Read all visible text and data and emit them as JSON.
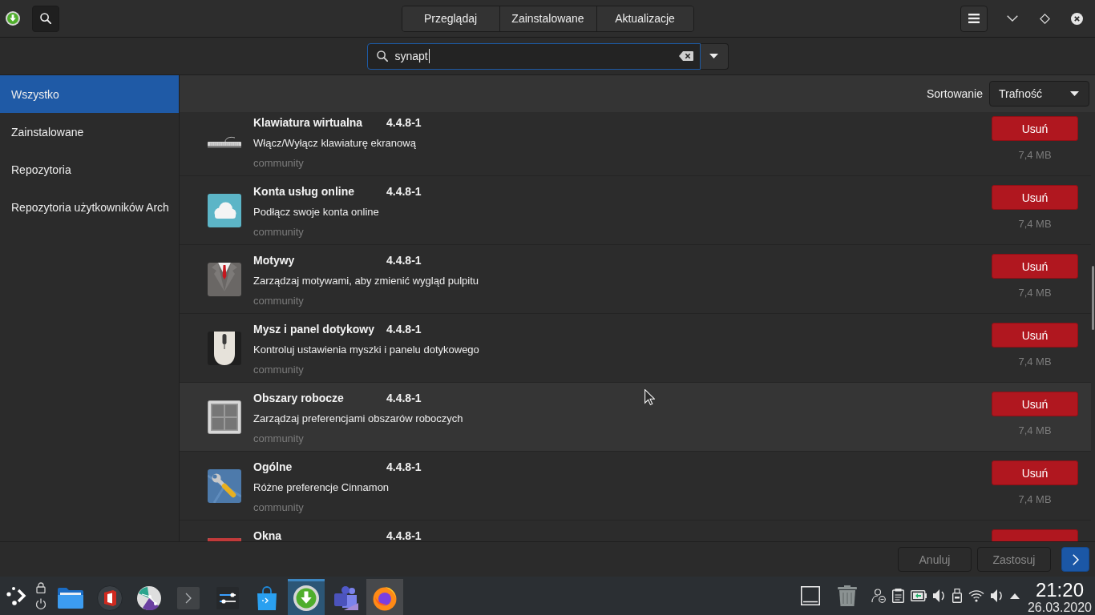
{
  "header": {
    "tabs": [
      {
        "label": "Przeglądaj",
        "selected": false
      },
      {
        "label": "Zainstalowane",
        "selected": false
      },
      {
        "label": "Aktualizacje",
        "selected": false
      }
    ]
  },
  "search": {
    "value": "synapt"
  },
  "sidebar": {
    "items": [
      {
        "label": "Wszystko",
        "selected": true
      },
      {
        "label": "Zainstalowane",
        "selected": false
      },
      {
        "label": "Repozytoria",
        "selected": false
      },
      {
        "label": "Repozytoria użytkowników Arch",
        "selected": false
      }
    ]
  },
  "sort": {
    "label": "Sortowanie",
    "value": "Trafność"
  },
  "packages": [
    {
      "name": "Klawiatura wirtualna",
      "version": "4.4.8-1",
      "description": "Włącz/Wyłącz klawiaturę ekranową",
      "repository": "community",
      "action": "Usuń",
      "size": "7,4 MB",
      "hovered": false
    },
    {
      "name": "Konta usług online",
      "version": "4.4.8-1",
      "description": "Podłącz swoje konta online",
      "repository": "community",
      "action": "Usuń",
      "size": "7,4 MB",
      "hovered": false
    },
    {
      "name": "Motywy",
      "version": "4.4.8-1",
      "description": "Zarządzaj motywami, aby zmienić wygląd pulpitu",
      "repository": "community",
      "action": "Usuń",
      "size": "7,4 MB",
      "hovered": false
    },
    {
      "name": "Mysz i panel dotykowy",
      "version": "4.4.8-1",
      "description": "Kontroluj ustawienia myszki i panelu dotykowego",
      "repository": "community",
      "action": "Usuń",
      "size": "7,4 MB",
      "hovered": false
    },
    {
      "name": "Obszary robocze",
      "version": "4.4.8-1",
      "description": "Zarządzaj preferencjami obszarów roboczych",
      "repository": "community",
      "action": "Usuń",
      "size": "7,4 MB",
      "hovered": true
    },
    {
      "name": "Ogólne",
      "version": "4.4.8-1",
      "description": "Różne preferencje Cinnamon",
      "repository": "community",
      "action": "Usuń",
      "size": "7,4 MB",
      "hovered": false
    },
    {
      "name": "Okna",
      "version": "4.4.8-1",
      "hovered": false
    }
  ],
  "footer": {
    "buttons": [
      {
        "label": "Anuluj",
        "disabled": true
      },
      {
        "label": "Zastosuj",
        "disabled": true
      }
    ]
  },
  "taskbar": {
    "apps": [
      {
        "selected": false,
        "open": false
      },
      {
        "selected": false,
        "open": false
      },
      {
        "selected": false,
        "open": false
      },
      {
        "selected": false,
        "open": false
      },
      {
        "selected": false,
        "open": false
      },
      {
        "selected": false,
        "open": false
      },
      {
        "selected": true,
        "open": true
      },
      {
        "selected": false,
        "open": false
      },
      {
        "selected": false,
        "open": true
      }
    ],
    "clock": {
      "time": "21:20",
      "date": "26.03.2020"
    }
  }
}
